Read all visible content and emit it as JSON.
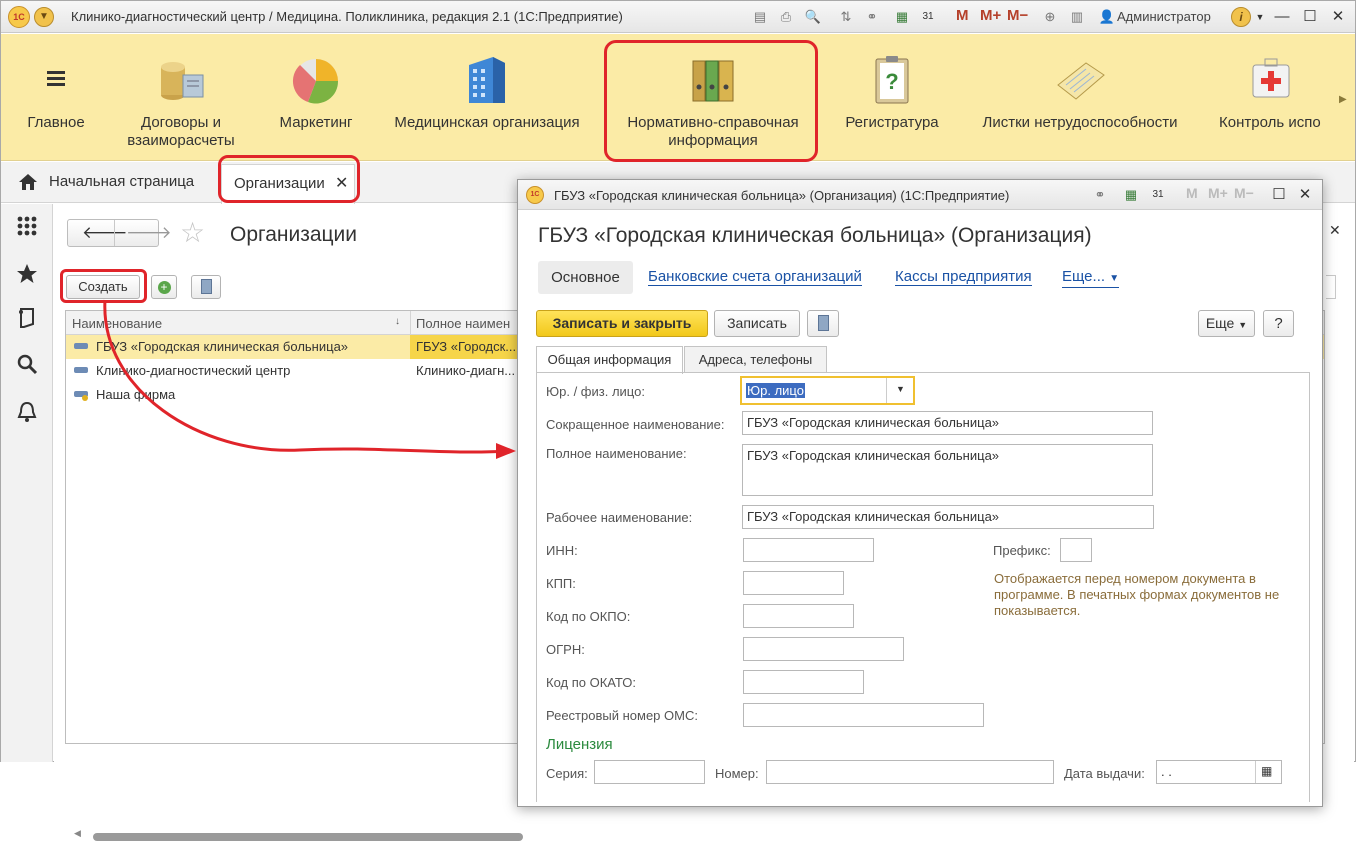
{
  "app": {
    "title": "Клинико-диагностический центр / Медицина. Поликлиника, редакция 2.1  (1С:Предприятие)",
    "logo": "1С",
    "user": "Администратор",
    "m_buttons": [
      "M",
      "M+",
      "M−"
    ]
  },
  "sections": [
    {
      "label": "Главное",
      "icon": "menu-icon"
    },
    {
      "label": "Договоры и\nвзаиморасчеты",
      "icon": "coins-icon"
    },
    {
      "label": "Маркетинг",
      "icon": "pie-chart-icon"
    },
    {
      "label": "Медицинская организация",
      "icon": "building-icon"
    },
    {
      "label": "Нормативно-справочная\nинформация",
      "icon": "binders-icon"
    },
    {
      "label": "Регистратура",
      "icon": "clipboard-icon"
    },
    {
      "label": "Листки нетрудоспособности",
      "icon": "notepad-icon"
    },
    {
      "label": "Контроль испо",
      "icon": "first-aid-icon"
    }
  ],
  "tabs": {
    "home": "Начальная страница",
    "active": "Организации",
    "close": "✕"
  },
  "list": {
    "title": "Организации",
    "create_button": "Создать",
    "columns": [
      "Наименование",
      "Полное наимен"
    ],
    "rows": [
      {
        "name": "ГБУЗ «Городская клиническая больница»",
        "full": "ГБУЗ «Городск..."
      },
      {
        "name": "Клинико-диагностический центр",
        "full": "Клинико-диагн..."
      },
      {
        "name": "Наша фирма",
        "full": ""
      }
    ]
  },
  "modal": {
    "window_title": "ГБУЗ «Городская клиническая больница» (Организация)  (1С:Предприятие)",
    "heading": "ГБУЗ «Городская клиническая больница» (Организация)",
    "nav": {
      "main": "Основное",
      "bank": "Банковские счета организаций",
      "cash": "Кассы предприятия",
      "more": "Еще..."
    },
    "toolbar": {
      "save_close": "Записать и закрыть",
      "save": "Записать",
      "more": "Еще",
      "help": "?"
    },
    "form_tabs": [
      "Общая информация",
      "Адреса, телефоны"
    ],
    "fields": {
      "legal_label": "Юр. / физ. лицо:",
      "legal_value": "Юр. лицо",
      "short_label": "Сокращенное наименование:",
      "short_value": "ГБУЗ «Городская клиническая больница»",
      "full_label": "Полное наименование:",
      "full_value": "ГБУЗ «Городская клиническая больница»",
      "work_label": "Рабочее наименование:",
      "work_value": "ГБУЗ «Городская клиническая больница»",
      "inn_label": "ИНН:",
      "kpp_label": "КПП:",
      "okpo_label": "Код по ОКПО:",
      "ogrn_label": "ОГРН:",
      "okato_label": "Код по ОКАТО:",
      "oms_label": "Реестровый номер ОМС:",
      "prefix_label": "Префикс:",
      "prefix_hint": "Отображается перед номером документа в программе. В печатных формах документов не показывается."
    },
    "license": {
      "title": "Лицензия",
      "series_label": "Серия:",
      "number_label": "Номер:",
      "date_label": "Дата выдачи:",
      "date_placeholder": " .  ."
    }
  }
}
